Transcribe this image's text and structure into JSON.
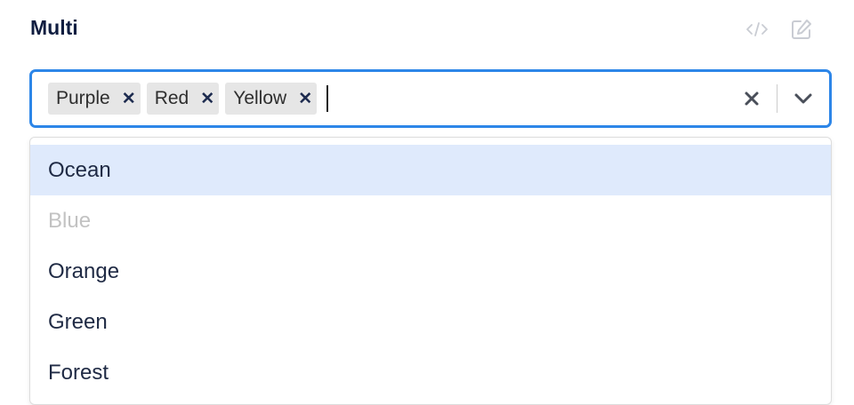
{
  "field": {
    "title": "Multi"
  },
  "toolbar": {
    "code_icon": "code-icon",
    "edit_icon": "edit-icon"
  },
  "select": {
    "selected": [
      "Purple",
      "Red",
      "Yellow"
    ],
    "input_value": "",
    "clear_icon": "close-icon",
    "dropdown_icon": "chevron-down-icon",
    "accent_color": "#2d86e8"
  },
  "menu": {
    "options": [
      {
        "label": "Ocean",
        "state": "focused"
      },
      {
        "label": "Blue",
        "state": "disabled"
      },
      {
        "label": "Orange",
        "state": "normal"
      },
      {
        "label": "Green",
        "state": "normal"
      },
      {
        "label": "Forest",
        "state": "normal"
      }
    ]
  }
}
